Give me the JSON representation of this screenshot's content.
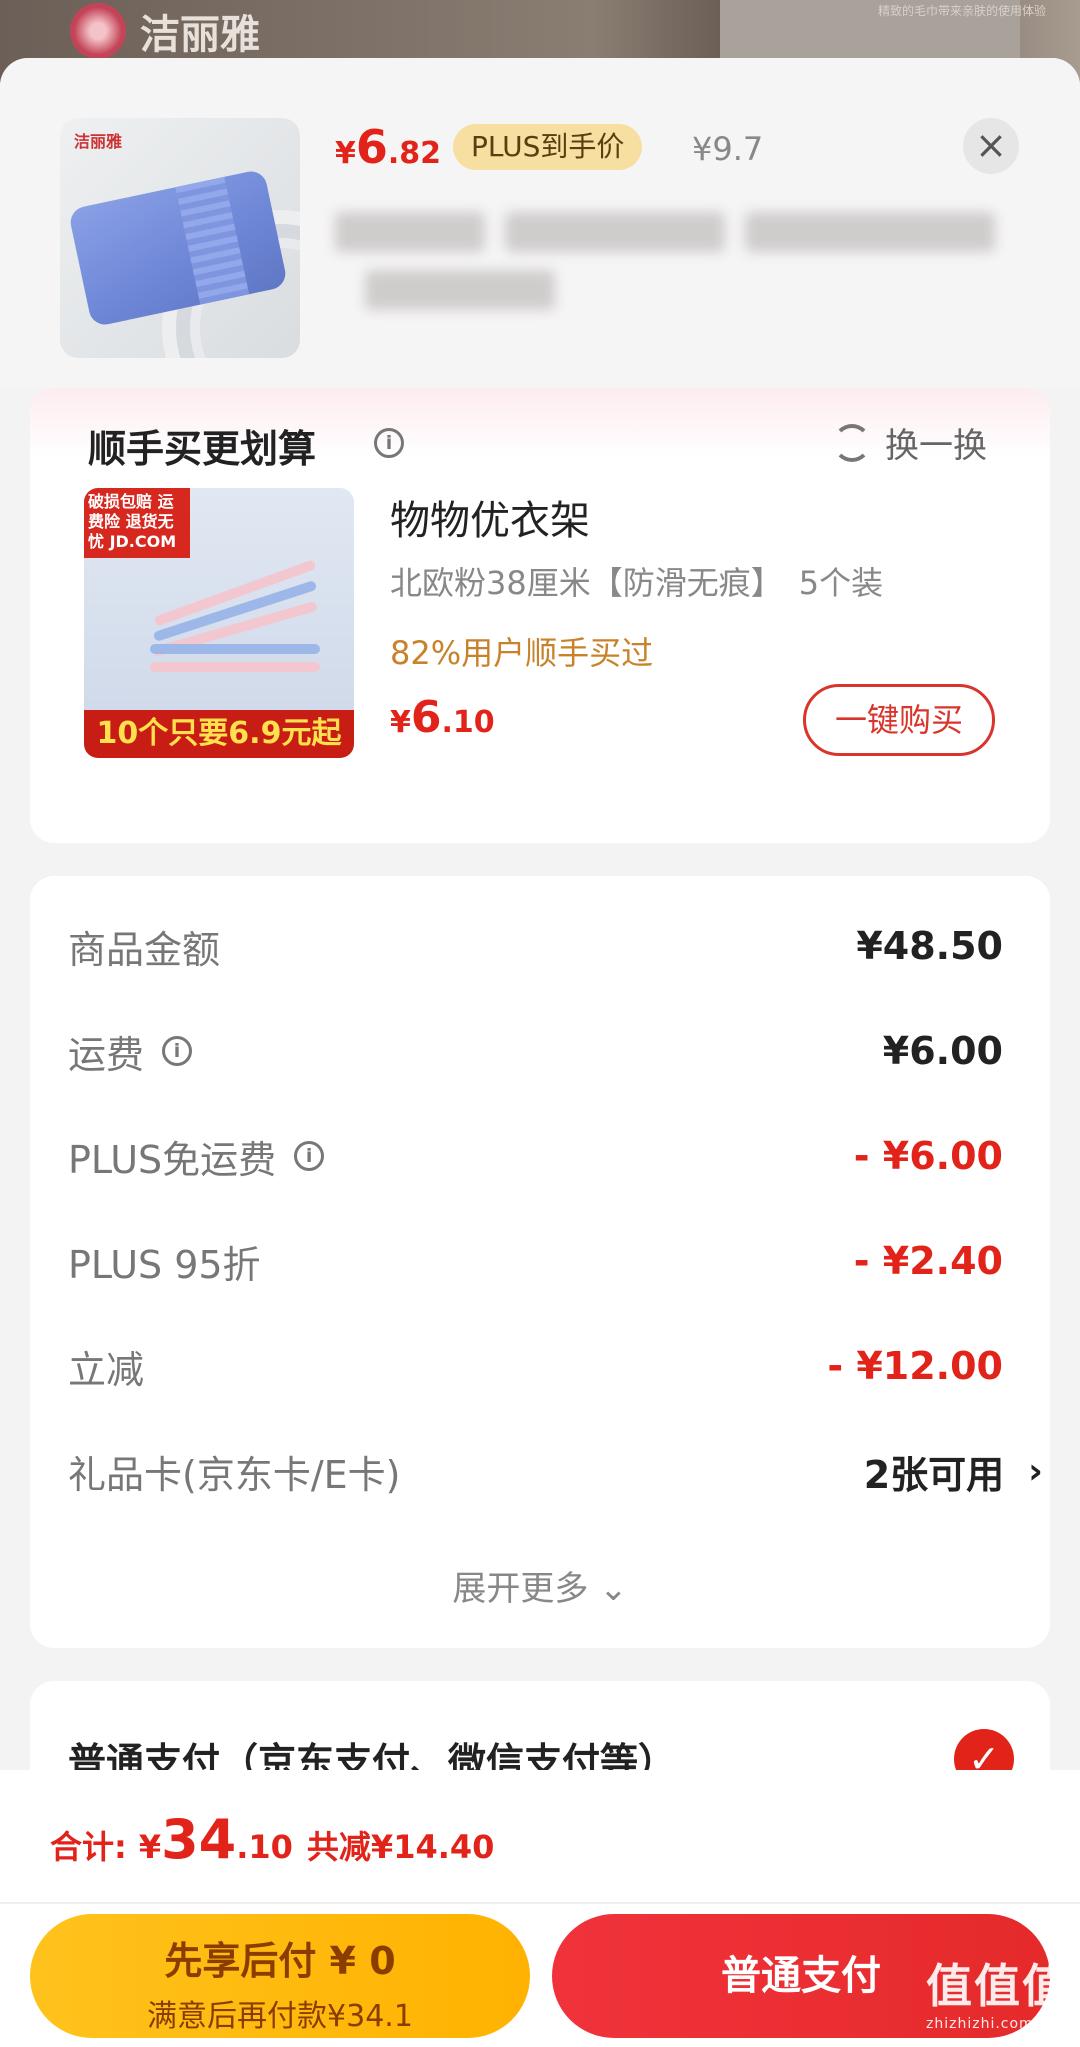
{
  "background": {
    "brand_name": "洁丽雅",
    "note": "精致的毛巾带来亲肤的使用体验"
  },
  "product": {
    "price_yen": "¥",
    "price_int": "6",
    "price_dec": ".82",
    "plus_tag": "PLUS到手价",
    "original_price": "¥9.7",
    "close_icon": "×",
    "thumb_brand": "洁丽雅"
  },
  "recommend": {
    "title": "顺手买更划算",
    "info_icon": "i",
    "swap_label": "换一换",
    "item_badge": "破损包赔 运费险 退货无忧 JD.COM",
    "item_promo": "10个只要6.9元起",
    "item_name": "物物优衣架",
    "item_spec": "北欧粉38厘米【防滑无痕】　5个装",
    "item_stat": "82%用户顺手买过",
    "price_yen": "¥",
    "price_int": "6",
    "price_dec": ".10",
    "buy_label": "一键购买"
  },
  "summary": {
    "rows": [
      {
        "label": "商品金额",
        "value": "¥48.50"
      },
      {
        "label": "运费",
        "value": "¥6.00"
      },
      {
        "label": "PLUS免运费",
        "value": "- ¥6.00"
      },
      {
        "label": "PLUS 95折",
        "value": "- ¥2.40"
      },
      {
        "label": "立减",
        "value": "- ¥12.00"
      },
      {
        "label": "礼品卡(京东卡/E卡)",
        "value": "2张可用"
      }
    ],
    "expand_label": "展开更多 ⌄",
    "chevron": "›"
  },
  "payment": {
    "label": "普通支付（京东支付、微信支付等）",
    "check": "✓"
  },
  "bottom": {
    "total_label": "合计:",
    "total_yen": "¥",
    "total_int": "34",
    "total_dec": ".10",
    "save_text": "共减¥14.40",
    "later_main": "先享后付 ¥ 0",
    "later_sub": "满意后再付款¥34.1",
    "normal_pay": "普通支付"
  },
  "watermark": {
    "text": "值值值",
    "sub": "zhizhizhi.com"
  },
  "colors": {
    "accent_red": "#e2231a",
    "plus_gold": "#f6dfa0",
    "later_yellow": "#ffc21c",
    "stat_orange": "#c8822a"
  }
}
